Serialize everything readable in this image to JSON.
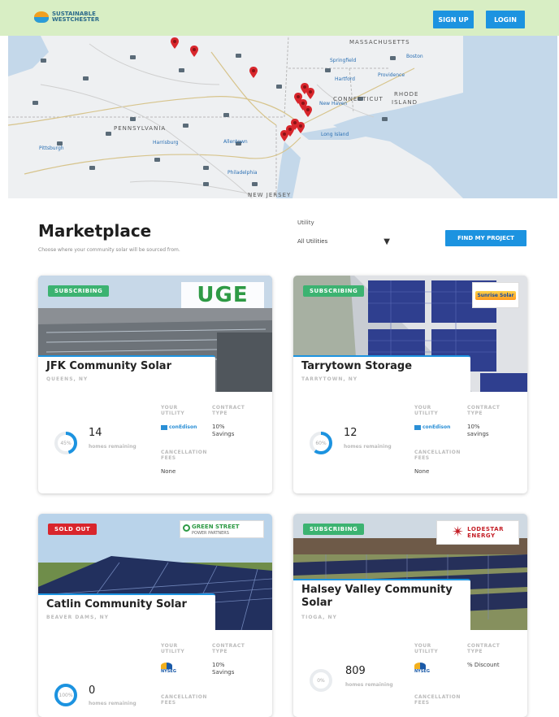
{
  "header": {
    "logo_line1": "SUSTAINABLE",
    "logo_line2": "WESTCHESTER",
    "signup": "SIGN UP",
    "login": "LOGIN"
  },
  "map": {
    "labels": {
      "massachusetts": "MASSACHUSETTS",
      "connecticut": "CONNECTICUT",
      "rhode_island_1": "RHODE",
      "rhode_island_2": "ISLAND",
      "pennsylvania": "PENNSYLVANIA",
      "new_jersey": "NEW JERSEY"
    },
    "cities": {
      "boston": "Boston",
      "hartford": "Hartford",
      "providence": "Providence",
      "new_haven": "New Haven",
      "springfield": "Springfield",
      "pittsburgh": "Pittsburgh",
      "harrisburg": "Harrisburg",
      "allentown": "Allentown",
      "philadelphia": "Philadelphia",
      "long_island": "Long Island"
    }
  },
  "marketplace": {
    "title": "Marketplace",
    "subtitle": "Choose where your community solar will be sourced from.",
    "utility_label": "Utility",
    "utility_value": "All Utilities",
    "find_button": "FIND MY PROJECT"
  },
  "cards": [
    {
      "badge": "SUBSCRIBING",
      "brand": "UGE",
      "name": "JFK Community Solar",
      "location": "QUEENS, NY",
      "percent_label": "45%",
      "percent": 0.45,
      "homes": "14",
      "homes_label": "homes remaining",
      "utility_label_1": "YOUR",
      "utility_label_2": "UTILITY",
      "utility_name": "conEdison",
      "contract_label_1": "CONTRACT",
      "contract_label_2": "TYPE",
      "contract_1": "10%",
      "contract_2": "Savings",
      "cancel_label_1": "CANCELLATION",
      "cancel_label_2": "FEES",
      "cancel_val": "None"
    },
    {
      "badge": "SUBSCRIBING",
      "brand": "Sunrise Solar",
      "name": "Tarrytown Storage",
      "location": "TARRYTOWN, NY",
      "percent_label": "60%",
      "percent": 0.6,
      "homes": "12",
      "homes_label": "homes remaining",
      "utility_label_1": "YOUR",
      "utility_label_2": "UTILITY",
      "utility_name": "conEdison",
      "contract_label_1": "CONTRACT",
      "contract_label_2": "TYPE",
      "contract_1": "10%",
      "contract_2": "savings",
      "cancel_label_1": "CANCELLATION",
      "cancel_label_2": "FEES",
      "cancel_val": "None"
    },
    {
      "badge": "SOLD OUT",
      "brand_line1": "GREEN STREET",
      "brand_line2": "POWER PARTNERS",
      "name": "Catlin Community Solar",
      "location": "BEAVER DAMS, NY",
      "percent_label": "100%",
      "percent": 1.0,
      "homes": "0",
      "homes_label": "homes remaining",
      "utility_label_1": "YOUR",
      "utility_label_2": "UTILITY",
      "utility_name": "NYSEG",
      "contract_label_1": "CONTRACT",
      "contract_label_2": "TYPE",
      "contract_1": "10%",
      "contract_2": "Savings",
      "cancel_label_1": "CANCELLATION",
      "cancel_label_2": "FEES"
    },
    {
      "badge": "SUBSCRIBING",
      "brand_line1": "LODESTAR",
      "brand_line2": "ENERGY",
      "name_line1": "Halsey Valley Community",
      "name_line2": "Solar",
      "location": "TIOGA, NY",
      "percent_label": "0%",
      "percent": 0.0,
      "homes": "809",
      "homes_label": "homes remaining",
      "utility_label_1": "YOUR",
      "utility_label_2": "UTILITY",
      "utility_name": "NYSEG",
      "contract_label_1": "CONTRACT",
      "contract_label_2": "TYPE",
      "contract_1": "% Discount",
      "cancel_label_1": "CANCELLATION",
      "cancel_label_2": "FEES"
    }
  ],
  "colors": {
    "accent": "#1c93e0",
    "header_bg": "#d8eec4",
    "subscribing": "#3cb371",
    "sold_out": "#d9252c",
    "pin": "#d8262c"
  }
}
